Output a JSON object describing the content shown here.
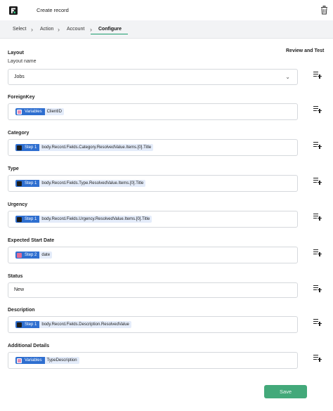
{
  "header": {
    "title": "Create record"
  },
  "steps": [
    "Select",
    "Action",
    "Account",
    "Configure"
  ],
  "layout": {
    "label": "Layout",
    "sublabel": "Layout name",
    "value": "Jobs"
  },
  "review_test": "Review and Test",
  "fields": {
    "foreignkey": {
      "label": "ForeignKey",
      "chip_source": "Variables",
      "chip_value": "ClientID"
    },
    "category": {
      "label": "Category",
      "chip_source": "Step 1",
      "chip_value": "body.Record.Fields.Category.ResolvedValue.Items.[0].Title"
    },
    "type": {
      "label": "Type",
      "chip_source": "Step 1",
      "chip_value": "body.Record.Fields.Type.ResolvedValue.Items.[0].Title"
    },
    "urgency": {
      "label": "Urgency",
      "chip_source": "Step 1",
      "chip_value": "body.Record.Fields.Urgency.ResolvedValue.Items.[0].Title"
    },
    "expected_start_date": {
      "label": "Expected Start Date",
      "chip_source": "Step 2",
      "chip_value": "date"
    },
    "status": {
      "label": "Status",
      "value": "New"
    },
    "description": {
      "label": "Description",
      "chip_source": "Step 1",
      "chip_value": "body.Record.Fields.Description.ResolvedValue"
    },
    "additional_details": {
      "label": "Additional Details",
      "chip_source": "Variables",
      "chip_value": "TypeDescription"
    }
  },
  "save_label": "Save"
}
